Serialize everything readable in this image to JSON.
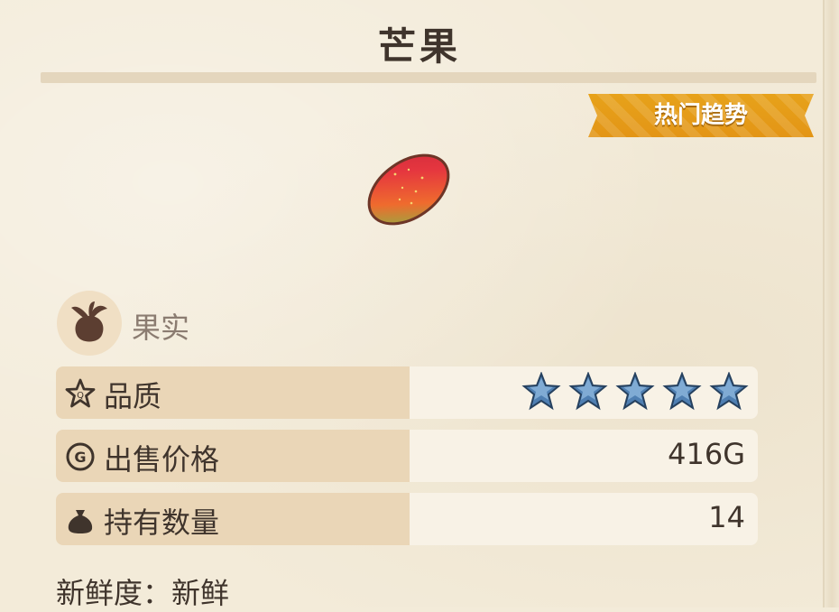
{
  "item": {
    "name": "芒果",
    "badge": "热门趋势",
    "category": "果实"
  },
  "stats": {
    "quality_label": "品质",
    "quality_stars": 5,
    "price_label": "出售价格",
    "price_value": "416G",
    "quantity_label": "持有数量",
    "quantity_value": "14"
  },
  "freshness": {
    "text": "新鲜度：新鲜"
  },
  "colors": {
    "badge": "#e5a31a",
    "label_bg": "#ead6b7",
    "value_bg": "#f8f2e6",
    "star": "#4f7fb2"
  },
  "icons": {
    "category": "turnip-icon",
    "quality": "star-outline-icon",
    "price": "gold-coin-icon",
    "quantity": "money-bag-icon"
  }
}
